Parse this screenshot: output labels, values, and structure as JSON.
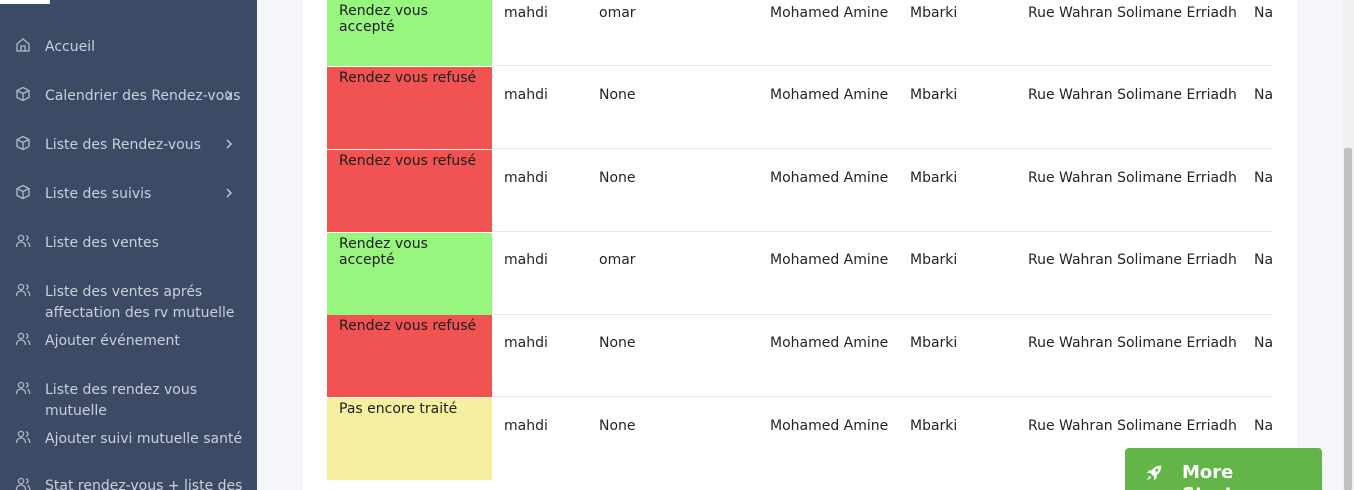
{
  "sidebar": {
    "items": [
      {
        "label": "Accueil",
        "icon": "home-icon",
        "chevron": false
      },
      {
        "label": "Calendrier des Rendez-vous",
        "icon": "box-icon",
        "chevron": true
      },
      {
        "label": "Liste des Rendez-vous",
        "icon": "box-icon",
        "chevron": true
      },
      {
        "label": "Liste des suivis",
        "icon": "box-icon",
        "chevron": true
      },
      {
        "label": "Liste des ventes",
        "icon": "users-icon",
        "chevron": false
      },
      {
        "label": "Liste des ventes aprés affectation des rv mutuelle",
        "icon": "users-icon",
        "chevron": false
      },
      {
        "label": "Ajouter événement",
        "icon": "users-icon",
        "chevron": false
      },
      {
        "label": "Liste des rendez vous mutuelle",
        "icon": "users-icon",
        "chevron": false
      },
      {
        "label": "Ajouter suivi mutuelle santé",
        "icon": "users-icon",
        "chevron": false
      },
      {
        "label": "Stat rendez-vous + liste des",
        "icon": "users-icon",
        "chevron": false
      }
    ]
  },
  "colors": {
    "accepted": "#98f57f",
    "refused": "#f15353",
    "pending": "#f5f0a0",
    "sidebar": "#3d4a66",
    "starters": "#63b547"
  },
  "table": {
    "rows": [
      {
        "status": "Rendez vous accepté",
        "status_type": "accepted",
        "c1": "mahdi",
        "c2": "omar",
        "prenom": "Mohamed Amine",
        "nom": "Mbarki",
        "adresse": "Rue Wahran Solimane Erriadh",
        "next": "Na"
      },
      {
        "status": "Rendez vous refusé",
        "status_type": "refused",
        "c1": "mahdi",
        "c2": "None",
        "prenom": "Mohamed Amine",
        "nom": "Mbarki",
        "adresse": "Rue Wahran Solimane Erriadh",
        "next": "Na"
      },
      {
        "status": "Rendez vous refusé",
        "status_type": "refused",
        "c1": "mahdi",
        "c2": "None",
        "prenom": "Mohamed Amine",
        "nom": "Mbarki",
        "adresse": "Rue Wahran Solimane Erriadh",
        "next": "Na"
      },
      {
        "status": "Rendez vous accepté",
        "status_type": "accepted",
        "c1": "mahdi",
        "c2": "omar",
        "prenom": "Mohamed Amine",
        "nom": "Mbarki",
        "adresse": "Rue Wahran Solimane Erriadh",
        "next": "Na"
      },
      {
        "status": "Rendez vous refusé",
        "status_type": "refused",
        "c1": "mahdi",
        "c2": "None",
        "prenom": "Mohamed Amine",
        "nom": "Mbarki",
        "adresse": "Rue Wahran Solimane Erriadh",
        "next": "Na"
      },
      {
        "status": "Pas encore traité",
        "status_type": "pending",
        "c1": "mahdi",
        "c2": "None",
        "prenom": "Mohamed Amine",
        "nom": "Mbarki",
        "adresse": "Rue Wahran Solimane Erriadh",
        "next": "Na"
      }
    ]
  },
  "starters": {
    "label": "More Starters",
    "icon": "rocket-icon"
  }
}
